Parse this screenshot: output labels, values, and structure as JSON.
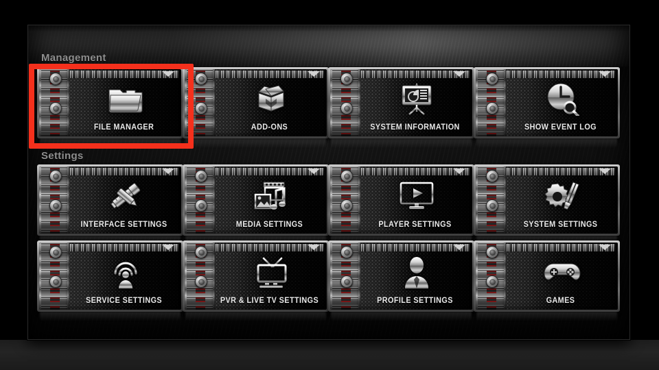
{
  "window": {
    "title": "Kodi Settings",
    "accent_red": "#f5301c",
    "chrome_light": "#e8e8e8",
    "chrome_dark": "#3a3a3a",
    "label_gray": "#8e8e8e"
  },
  "sections": [
    {
      "id": "management",
      "label": "Management"
    },
    {
      "id": "settings",
      "label": "Settings"
    }
  ],
  "tiles": [
    {
      "label": "FILE MANAGER",
      "icon": "folder-icon",
      "selected": true
    },
    {
      "label": "ADD-ONS",
      "icon": "open-box-icon",
      "selected": false
    },
    {
      "label": "SYSTEM INFORMATION",
      "icon": "presentation-chart-icon",
      "selected": false
    },
    {
      "label": "SHOW EVENT LOG",
      "icon": "clock-search-icon",
      "selected": false
    },
    {
      "label": "INTERFACE SETTINGS",
      "icon": "paintbrush-ruler-icon",
      "selected": false
    },
    {
      "label": "MEDIA SETTINGS",
      "icon": "filmstrip-music-icon",
      "selected": false
    },
    {
      "label": "PLAYER SETTINGS",
      "icon": "monitor-play-icon",
      "selected": false
    },
    {
      "label": "SYSTEM SETTINGS",
      "icon": "gear-tools-icon",
      "selected": false
    },
    {
      "label": "SERVICE SETTINGS",
      "icon": "broadcast-person-icon",
      "selected": false
    },
    {
      "label": "PVR & LIVE TV SETTINGS",
      "icon": "tv-antenna-icon",
      "selected": false
    },
    {
      "label": "PROFILE SETTINGS",
      "icon": "person-icon",
      "selected": false
    },
    {
      "label": "GAMES",
      "icon": "gamepad-icon",
      "selected": false
    }
  ],
  "annotation": {
    "target": "FILE MANAGER",
    "color": "#f5301c"
  }
}
